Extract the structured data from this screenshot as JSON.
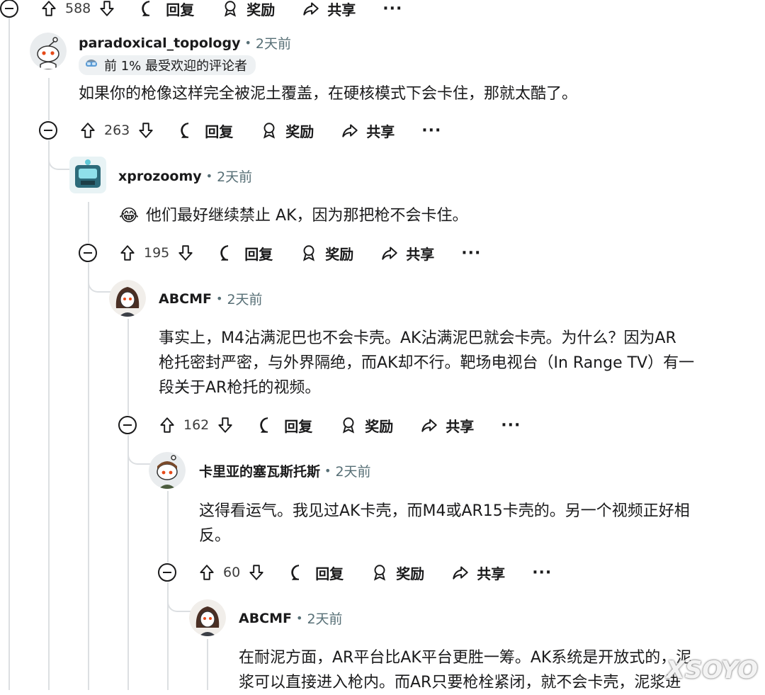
{
  "comments": [
    {
      "id": "c0",
      "score": "588"
    },
    {
      "id": "c1",
      "author": "paradoxical_topology",
      "time": "2天前",
      "badge": "前 1% 最受欢迎的评论者",
      "lines": [
        "如果你的枪像这样完全被泥土覆盖，在硬核模式下会卡住，那就太酷了。"
      ],
      "score": "263"
    },
    {
      "id": "c2",
      "author": "xprozoomy",
      "time": "2天前",
      "emoji": "😂",
      "lines": [
        "他们最好继续禁止 AK，因为那把枪不会卡住。"
      ],
      "score": "195"
    },
    {
      "id": "c3",
      "author": "ABCMF",
      "time": "2天前",
      "lines": [
        "事实上，M4沾满泥巴也不会卡壳。AK沾满泥巴就会卡壳。为什么？因为AR",
        "枪托密封严密，与外界隔绝，而AK却不行。靶场电视台（In Range TV）有一",
        "段关于AR枪托的视频。"
      ],
      "score": "162"
    },
    {
      "id": "c4",
      "author": "卡里亚的塞瓦斯托斯",
      "time": "2天前",
      "lines": [
        "这得看运气。我见过AK卡壳，而M4或AR15卡壳的。另一个视频正好相",
        "反。"
      ],
      "score": "60"
    },
    {
      "id": "c5",
      "author": "ABCMF",
      "time": "2天前",
      "lines": [
        "在耐泥方面，AR平台比AK平台更胜一筹。AK系统是开放式的，泥",
        "浆可以直接进入枪内。而AR只要枪栓紧闭，就不会卡壳，泥浆进"
      ]
    }
  ],
  "actions": {
    "reply": "回复",
    "award": "奖励",
    "share": "共享",
    "more": "···"
  },
  "watermark": "XSOYO",
  "colors": {
    "text": "#1a1a1b",
    "meta": "#576f76",
    "thread": "#dcdfe2",
    "badge_bg": "#eef1f3"
  }
}
